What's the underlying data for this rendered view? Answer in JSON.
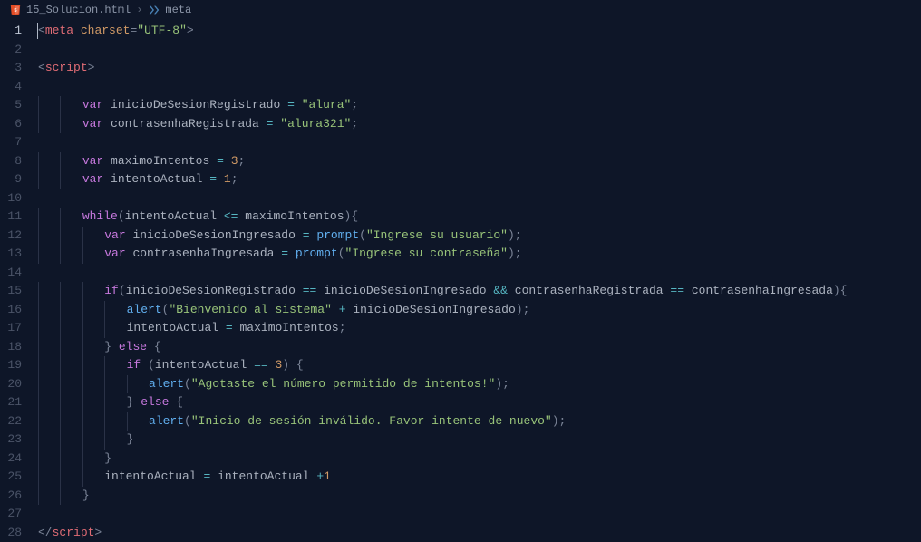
{
  "breadcrumb": {
    "file": "15_Solucion.html",
    "symbol": "meta"
  },
  "currentLine": 1,
  "lines": [
    {
      "n": 1,
      "tokens": [
        {
          "t": "<",
          "c": "c-punct"
        },
        {
          "t": "meta",
          "c": "c-tag"
        },
        {
          "t": " ",
          "c": ""
        },
        {
          "t": "charset",
          "c": "c-attr"
        },
        {
          "t": "=",
          "c": "c-punct"
        },
        {
          "t": "\"UTF-8\"",
          "c": "c-str"
        },
        {
          "t": ">",
          "c": "c-punct"
        }
      ]
    },
    {
      "n": 2,
      "tokens": []
    },
    {
      "n": 3,
      "tokens": [
        {
          "t": "<",
          "c": "c-punct"
        },
        {
          "t": "script",
          "c": "c-tag"
        },
        {
          "t": ">",
          "c": "c-punct"
        }
      ]
    },
    {
      "n": 4,
      "tokens": []
    },
    {
      "n": 5,
      "indent": 2,
      "tokens": [
        {
          "t": "var",
          "c": "c-kw"
        },
        {
          "t": " ",
          "c": ""
        },
        {
          "t": "inicioDeSesionRegistrado",
          "c": "c-name"
        },
        {
          "t": " ",
          "c": ""
        },
        {
          "t": "=",
          "c": "c-op"
        },
        {
          "t": " ",
          "c": ""
        },
        {
          "t": "\"alura\"",
          "c": "c-str"
        },
        {
          "t": ";",
          "c": "c-punct"
        }
      ]
    },
    {
      "n": 6,
      "indent": 2,
      "tokens": [
        {
          "t": "var",
          "c": "c-kw"
        },
        {
          "t": " ",
          "c": ""
        },
        {
          "t": "contrasenhaRegistrada",
          "c": "c-name"
        },
        {
          "t": " ",
          "c": ""
        },
        {
          "t": "=",
          "c": "c-op"
        },
        {
          "t": " ",
          "c": ""
        },
        {
          "t": "\"alura321\"",
          "c": "c-str"
        },
        {
          "t": ";",
          "c": "c-punct"
        }
      ]
    },
    {
      "n": 7,
      "tokens": []
    },
    {
      "n": 8,
      "indent": 2,
      "tokens": [
        {
          "t": "var",
          "c": "c-kw"
        },
        {
          "t": " ",
          "c": ""
        },
        {
          "t": "maximoIntentos",
          "c": "c-name"
        },
        {
          "t": " ",
          "c": ""
        },
        {
          "t": "=",
          "c": "c-op"
        },
        {
          "t": " ",
          "c": ""
        },
        {
          "t": "3",
          "c": "c-num"
        },
        {
          "t": ";",
          "c": "c-punct"
        }
      ]
    },
    {
      "n": 9,
      "indent": 2,
      "tokens": [
        {
          "t": "var",
          "c": "c-kw"
        },
        {
          "t": " ",
          "c": ""
        },
        {
          "t": "intentoActual",
          "c": "c-name"
        },
        {
          "t": " ",
          "c": ""
        },
        {
          "t": "=",
          "c": "c-op"
        },
        {
          "t": " ",
          "c": ""
        },
        {
          "t": "1",
          "c": "c-num"
        },
        {
          "t": ";",
          "c": "c-punct"
        }
      ]
    },
    {
      "n": 10,
      "tokens": []
    },
    {
      "n": 11,
      "indent": 2,
      "tokens": [
        {
          "t": "while",
          "c": "c-kw"
        },
        {
          "t": "(",
          "c": "c-punct"
        },
        {
          "t": "intentoActual",
          "c": "c-name"
        },
        {
          "t": " ",
          "c": ""
        },
        {
          "t": "<=",
          "c": "c-op"
        },
        {
          "t": " ",
          "c": ""
        },
        {
          "t": "maximoIntentos",
          "c": "c-name"
        },
        {
          "t": "){",
          "c": "c-punct"
        }
      ]
    },
    {
      "n": 12,
      "indent": 3,
      "tokens": [
        {
          "t": "var",
          "c": "c-kw"
        },
        {
          "t": " ",
          "c": ""
        },
        {
          "t": "inicioDeSesionIngresado",
          "c": "c-name"
        },
        {
          "t": " ",
          "c": ""
        },
        {
          "t": "=",
          "c": "c-op"
        },
        {
          "t": " ",
          "c": ""
        },
        {
          "t": "prompt",
          "c": "c-fn"
        },
        {
          "t": "(",
          "c": "c-punct"
        },
        {
          "t": "\"Ingrese su usuario\"",
          "c": "c-str"
        },
        {
          "t": ");",
          "c": "c-punct"
        }
      ]
    },
    {
      "n": 13,
      "indent": 3,
      "tokens": [
        {
          "t": "var",
          "c": "c-kw"
        },
        {
          "t": " ",
          "c": ""
        },
        {
          "t": "contrasenhaIngresada",
          "c": "c-name"
        },
        {
          "t": " ",
          "c": ""
        },
        {
          "t": "=",
          "c": "c-op"
        },
        {
          "t": " ",
          "c": ""
        },
        {
          "t": "prompt",
          "c": "c-fn"
        },
        {
          "t": "(",
          "c": "c-punct"
        },
        {
          "t": "\"Ingrese su contraseña\"",
          "c": "c-str"
        },
        {
          "t": ");",
          "c": "c-punct"
        }
      ]
    },
    {
      "n": 14,
      "tokens": []
    },
    {
      "n": 15,
      "indent": 3,
      "tokens": [
        {
          "t": "if",
          "c": "c-kw"
        },
        {
          "t": "(",
          "c": "c-punct"
        },
        {
          "t": "inicioDeSesionRegistrado",
          "c": "c-name"
        },
        {
          "t": " ",
          "c": ""
        },
        {
          "t": "==",
          "c": "c-op"
        },
        {
          "t": " ",
          "c": ""
        },
        {
          "t": "inicioDeSesionIngresado",
          "c": "c-name"
        },
        {
          "t": " ",
          "c": ""
        },
        {
          "t": "&&",
          "c": "c-op"
        },
        {
          "t": " ",
          "c": ""
        },
        {
          "t": "contrasenhaRegistrada",
          "c": "c-name"
        },
        {
          "t": " ",
          "c": ""
        },
        {
          "t": "==",
          "c": "c-op"
        },
        {
          "t": " ",
          "c": ""
        },
        {
          "t": "contrasenhaIngresada",
          "c": "c-name"
        },
        {
          "t": "){",
          "c": "c-punct"
        }
      ]
    },
    {
      "n": 16,
      "indent": 4,
      "tokens": [
        {
          "t": "alert",
          "c": "c-fn"
        },
        {
          "t": "(",
          "c": "c-punct"
        },
        {
          "t": "\"Bienvenido al sistema\"",
          "c": "c-str"
        },
        {
          "t": " ",
          "c": ""
        },
        {
          "t": "+",
          "c": "c-op"
        },
        {
          "t": " ",
          "c": ""
        },
        {
          "t": "inicioDeSesionIngresado",
          "c": "c-name"
        },
        {
          "t": ");",
          "c": "c-punct"
        }
      ]
    },
    {
      "n": 17,
      "indent": 4,
      "tokens": [
        {
          "t": "intentoActual",
          "c": "c-name"
        },
        {
          "t": " ",
          "c": ""
        },
        {
          "t": "=",
          "c": "c-op"
        },
        {
          "t": " ",
          "c": ""
        },
        {
          "t": "maximoIntentos",
          "c": "c-name"
        },
        {
          "t": ";",
          "c": "c-punct"
        }
      ]
    },
    {
      "n": 18,
      "indent": 3,
      "tokens": [
        {
          "t": "}",
          "c": "c-punct"
        },
        {
          "t": " ",
          "c": ""
        },
        {
          "t": "else",
          "c": "c-kw"
        },
        {
          "t": " ",
          "c": ""
        },
        {
          "t": "{",
          "c": "c-punct"
        }
      ]
    },
    {
      "n": 19,
      "indent": 4,
      "tokens": [
        {
          "t": "if",
          "c": "c-kw"
        },
        {
          "t": " (",
          "c": "c-punct"
        },
        {
          "t": "intentoActual",
          "c": "c-name"
        },
        {
          "t": " ",
          "c": ""
        },
        {
          "t": "==",
          "c": "c-op"
        },
        {
          "t": " ",
          "c": ""
        },
        {
          "t": "3",
          "c": "c-num"
        },
        {
          "t": ") {",
          "c": "c-punct"
        }
      ]
    },
    {
      "n": 20,
      "indent": 5,
      "tokens": [
        {
          "t": "alert",
          "c": "c-fn"
        },
        {
          "t": "(",
          "c": "c-punct"
        },
        {
          "t": "\"Agotaste el número permitido de intentos!\"",
          "c": "c-str"
        },
        {
          "t": ");",
          "c": "c-punct"
        }
      ]
    },
    {
      "n": 21,
      "indent": 4,
      "tokens": [
        {
          "t": "}",
          "c": "c-punct"
        },
        {
          "t": " ",
          "c": ""
        },
        {
          "t": "else",
          "c": "c-kw"
        },
        {
          "t": " ",
          "c": ""
        },
        {
          "t": "{",
          "c": "c-punct"
        }
      ]
    },
    {
      "n": 22,
      "indent": 5,
      "tokens": [
        {
          "t": "alert",
          "c": "c-fn"
        },
        {
          "t": "(",
          "c": "c-punct"
        },
        {
          "t": "\"Inicio de sesión inválido. Favor intente de nuevo\"",
          "c": "c-str"
        },
        {
          "t": ");",
          "c": "c-punct"
        }
      ]
    },
    {
      "n": 23,
      "indent": 4,
      "tokens": [
        {
          "t": "}",
          "c": "c-punct"
        }
      ]
    },
    {
      "n": 24,
      "indent": 3,
      "tokens": [
        {
          "t": "}",
          "c": "c-punct"
        }
      ]
    },
    {
      "n": 25,
      "indent": 3,
      "tokens": [
        {
          "t": "intentoActual",
          "c": "c-name"
        },
        {
          "t": " ",
          "c": ""
        },
        {
          "t": "=",
          "c": "c-op"
        },
        {
          "t": " ",
          "c": ""
        },
        {
          "t": "intentoActual",
          "c": "c-name"
        },
        {
          "t": " ",
          "c": ""
        },
        {
          "t": "+",
          "c": "c-op"
        },
        {
          "t": "1",
          "c": "c-num"
        }
      ]
    },
    {
      "n": 26,
      "indent": 2,
      "tokens": [
        {
          "t": "}",
          "c": "c-punct"
        }
      ]
    },
    {
      "n": 27,
      "tokens": []
    },
    {
      "n": 28,
      "tokens": [
        {
          "t": "</",
          "c": "c-punct"
        },
        {
          "t": "script",
          "c": "c-tag"
        },
        {
          "t": ">",
          "c": "c-punct"
        }
      ]
    }
  ]
}
